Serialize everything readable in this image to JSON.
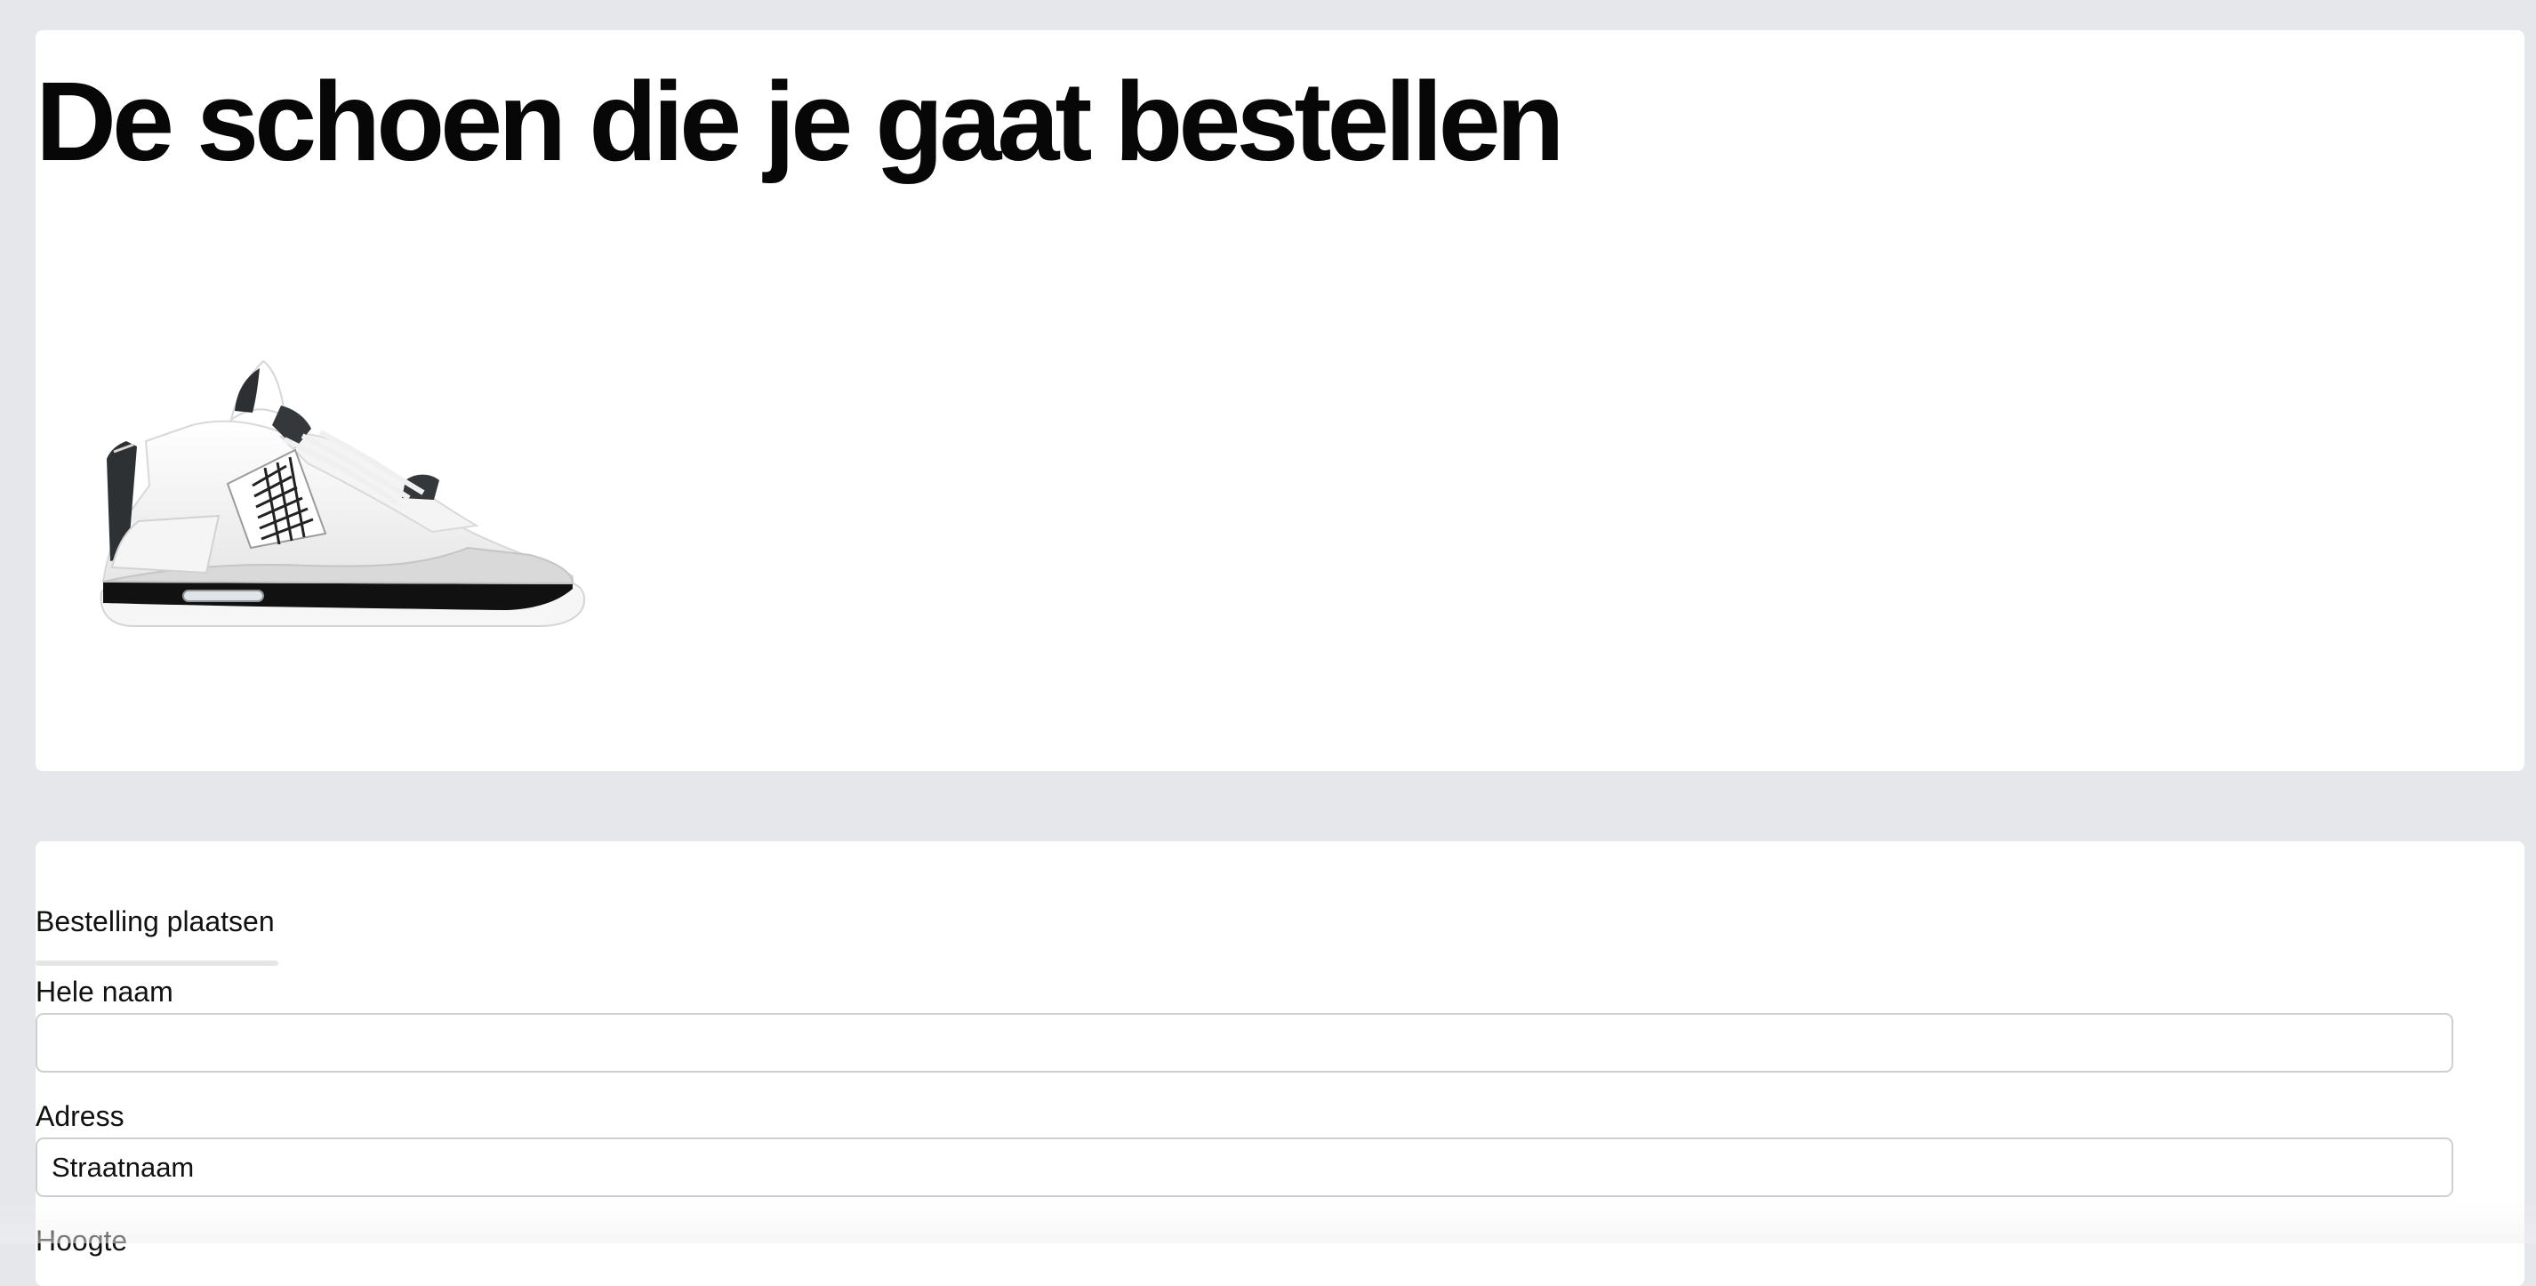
{
  "product": {
    "title": "De schoen die je gaat bestellen",
    "image_icon": "sneaker-image"
  },
  "form": {
    "section_title": "Bestelling plaatsen",
    "fields": [
      {
        "label": "Hele naam",
        "value": "",
        "placeholder": ""
      },
      {
        "label": "Adress",
        "value": "",
        "placeholder": "Straatnaam"
      },
      {
        "label": "Hoogte"
      }
    ]
  },
  "colors": {
    "background": "#e6e7eb",
    "card": "#ffffff",
    "title": "#070707",
    "input_border": "#cfcfd3"
  }
}
